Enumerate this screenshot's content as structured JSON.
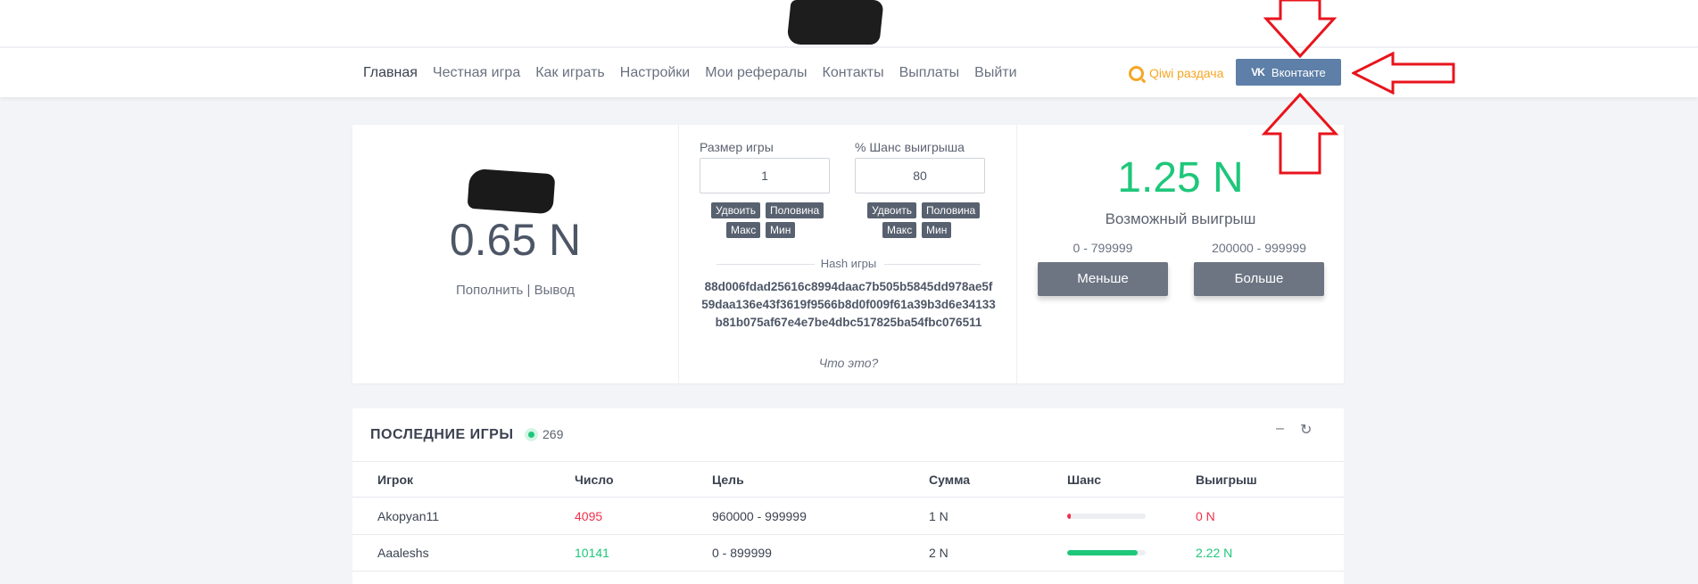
{
  "colors": {
    "accent_green": "#1ec77a",
    "loss_red": "#f0304a",
    "vk_blue": "#5d7fa8",
    "qiwi_orange": "#f5a623",
    "annotation_red": "#e8141c"
  },
  "nav": {
    "items": [
      "Главная",
      "Честная игра",
      "Как играть",
      "Настройки",
      "Мои рефералы",
      "Контакты",
      "Выплаты",
      "Выйти"
    ],
    "active": "Главная",
    "qiwi_label": "Qiwi раздача",
    "vk_label": "Вконтакте",
    "vk_icon": "vk-icon",
    "qiwi_icon": "qiwi-icon"
  },
  "balance": {
    "amount": "0.65 N",
    "deposit": "Пополнить",
    "separator": "|",
    "withdraw": "Вывод"
  },
  "bet": {
    "size_label": "Размер игры",
    "size_value": "1",
    "chance_label": "% Шанс выигрыша",
    "chance_value": "80",
    "size_buttons": [
      "Удвоить",
      "Половина",
      "Макс",
      "Мин"
    ],
    "chance_buttons": [
      "Удвоить",
      "Половина",
      "Макс",
      "Мин"
    ]
  },
  "hash": {
    "title": "Hash игры",
    "value": "88d006fdad25616c8994daac7b505b5845dd978ae5f59daa136e43f3619f9566b8d0f009f61a39b3d6e34133b81b075af67e4e7be4dbc517825ba54fbc076511",
    "help": "Что это?"
  },
  "win": {
    "amount": "1.25 N",
    "label": "Возможный выигрыш",
    "range_low": "0 - 799999",
    "range_high": "200000 - 999999",
    "less_button": "Меньше",
    "more_button": "Больше"
  },
  "games": {
    "title": "ПОСЛЕДНИЕ ИГРЫ",
    "online_count": "269",
    "minimize_icon": "minus-icon",
    "refresh_icon": "refresh-icon",
    "columns": [
      "Игрок",
      "Число",
      "Цель",
      "Сумма",
      "Шанс",
      "Выигрыш"
    ],
    "rows": [
      {
        "player": "Akopyan11",
        "number": "4095",
        "target": "960000 - 999999",
        "sum": "1 N",
        "chance": 4,
        "win": "0 N",
        "result": "loss"
      },
      {
        "player": "Aaaleshs",
        "number": "10141",
        "target": "0 - 899999",
        "sum": "2 N",
        "chance": 90,
        "win": "2.22 N",
        "result": "win"
      }
    ]
  }
}
